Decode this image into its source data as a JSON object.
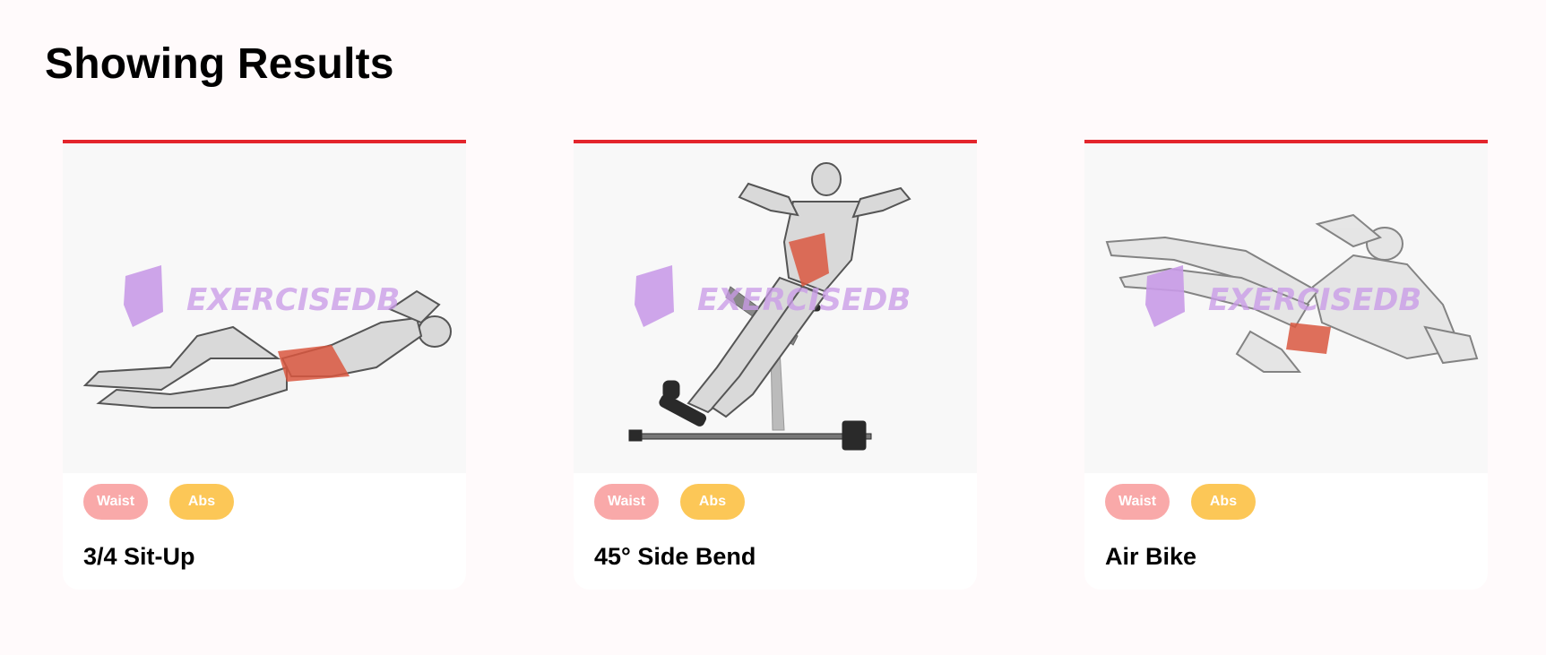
{
  "page": {
    "title": "Showing Results"
  },
  "colors": {
    "accent": "#e3252c",
    "tag_bodypart": "#f9a9a9",
    "tag_target": "#fcc757",
    "watermark": "#c99be8"
  },
  "exercises": [
    {
      "name": "3/4 Sit-Up",
      "body_part": "Waist",
      "target": "Abs",
      "pose": "sit-up"
    },
    {
      "name": "45° Side Bend",
      "body_part": "Waist",
      "target": "Abs",
      "pose": "side-bend"
    },
    {
      "name": "Air Bike",
      "body_part": "Waist",
      "target": "Abs",
      "pose": "air-bike"
    }
  ],
  "watermark": {
    "text": "EXERCISEDB"
  }
}
